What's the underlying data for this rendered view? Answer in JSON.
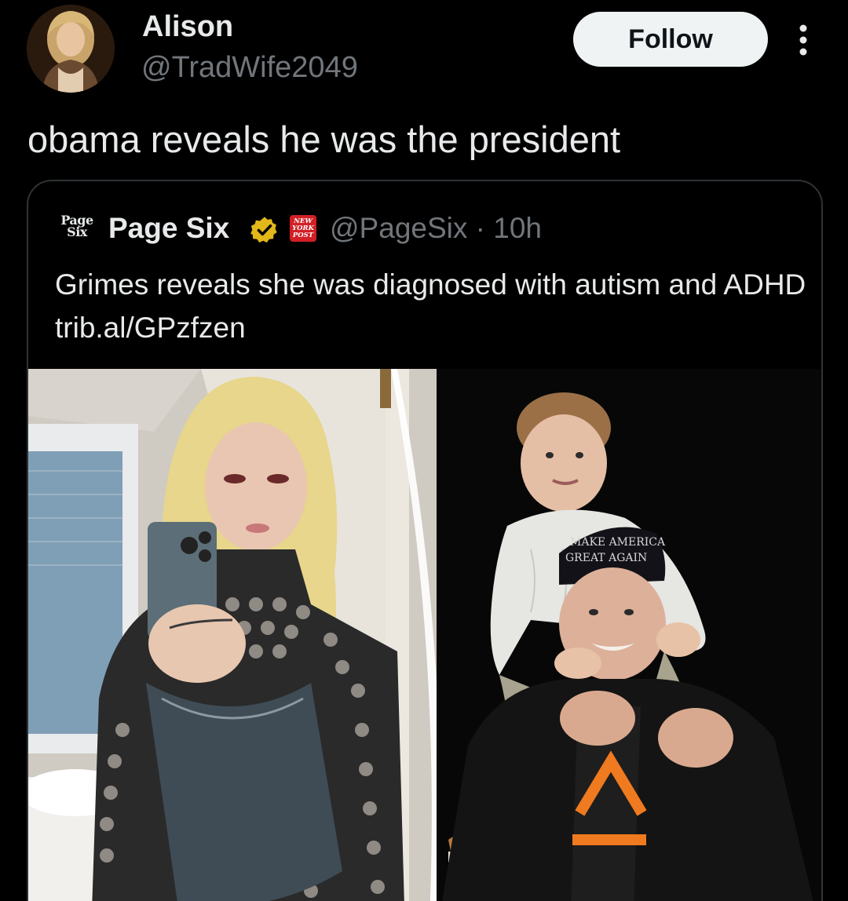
{
  "author": {
    "name": "Alison",
    "handle": "@TradWife2049",
    "avatar_icon": "profile-photo"
  },
  "actions": {
    "follow_label": "Follow",
    "more_icon": "more-vertical-icon"
  },
  "tweet": {
    "text": "obama reveals he was the president"
  },
  "quoted": {
    "avatar_text_line1": "Page",
    "avatar_text_line2": "Six",
    "name": "Page Six",
    "verified_icon": "verified-badge-icon",
    "affiliate_text_line1": "NEW",
    "affiliate_text_line2": "YORK",
    "affiliate_text_line3": "POST",
    "handle": "@PageSix",
    "separator": "·",
    "time": "10h",
    "text_prefix": "Grimes reveals she was diagnosed with autism and ADHD",
    "link": "trib.al/GPzfzen",
    "media": {
      "left_photo": "woman-mirror-selfie-photo",
      "right_photo": "man-with-child-on-shoulders-photo",
      "hat_text_line1": "MAKE AMERICA",
      "hat_text_line2": "GREAT AGAIN"
    }
  },
  "colors": {
    "background": "#000000",
    "text_primary": "#e7e9ea",
    "text_secondary": "#71767b",
    "border": "#2f3336",
    "follow_bg": "#eff3f4",
    "verified_gold": "#e2b719",
    "affiliate_red": "#d21f25"
  }
}
